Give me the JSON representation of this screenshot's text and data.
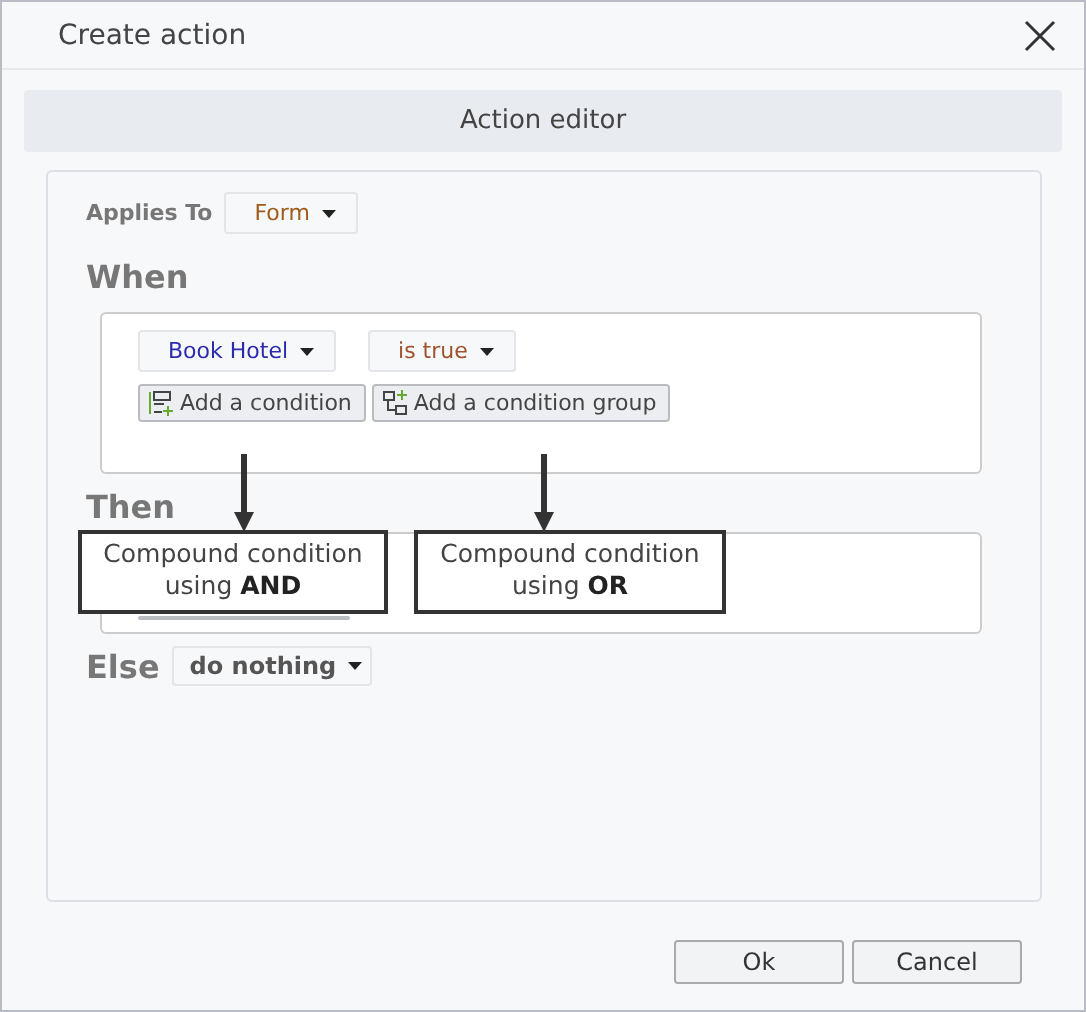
{
  "window": {
    "title": "Create action"
  },
  "header": "Action editor",
  "applies_to": {
    "label": "Applies To",
    "value": "Form"
  },
  "when": {
    "heading": "When",
    "condition": {
      "subject": "Book Hotel",
      "operator": "is true"
    },
    "buttons": [
      {
        "label": "Add a condition",
        "kind": "condition"
      },
      {
        "label": "Add a condition group",
        "kind": "group"
      }
    ]
  },
  "then": {
    "heading": "Then"
  },
  "else": {
    "heading": "Else",
    "value": "do nothing"
  },
  "callouts": [
    {
      "text": "Compound condition using **AND**"
    },
    {
      "text": "Compound condition using **OR**"
    }
  ],
  "buttons": [
    "Ok",
    "Cancel"
  ]
}
